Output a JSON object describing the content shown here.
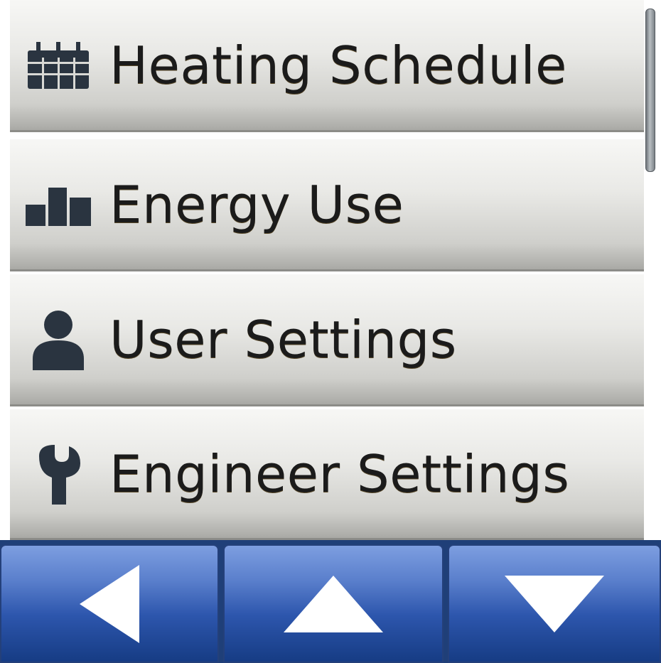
{
  "menu": {
    "items": [
      {
        "label": "Heating Schedule",
        "icon": "calendar-icon"
      },
      {
        "label": "Energy Use",
        "icon": "bar-chart-icon"
      },
      {
        "label": "User Settings",
        "icon": "user-icon"
      },
      {
        "label": "Engineer Settings",
        "icon": "wrench-icon"
      }
    ]
  },
  "navigation": {
    "back": {
      "icon": "left-arrow-icon"
    },
    "up": {
      "icon": "up-arrow-icon"
    },
    "down": {
      "icon": "down-arrow-icon"
    }
  },
  "colors": {
    "icon": "#2a3440",
    "text": "#1b1b1b",
    "nav": "#2d56ad"
  }
}
